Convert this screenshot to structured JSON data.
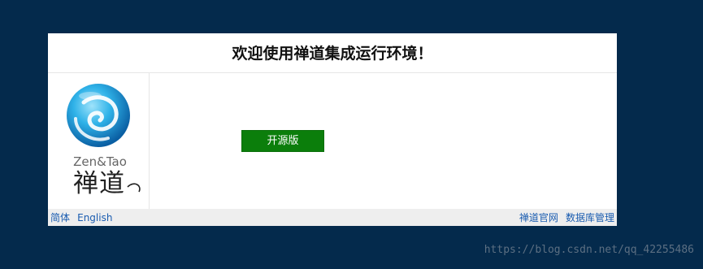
{
  "colors": {
    "page_background": "#042a4c",
    "panel_background": "#ffffff",
    "button_background": "#0b7e0b",
    "link": "#1a5cb0",
    "footer_background": "#eeeeee"
  },
  "panel": {
    "title": "欢迎使用禅道集成运行环境！"
  },
  "logo": {
    "brand_en": "Zen&Tao",
    "brand_cn": "禅道",
    "icon": "zentao-swirl-logo-icon"
  },
  "main": {
    "open_source_button_label": "开源版"
  },
  "footer": {
    "language_simplified": "简体",
    "language_english": "English",
    "official_site_link": "禅道官网",
    "db_admin_link": "数据库管理"
  },
  "watermark": {
    "text": "https://blog.csdn.net/qq_42255486"
  }
}
